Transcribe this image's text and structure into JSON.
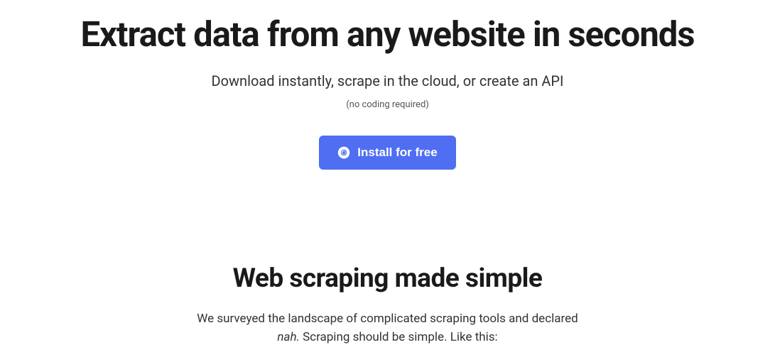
{
  "hero": {
    "title": "Extract data from any website in seconds",
    "subtitle": "Download instantly, scrape in the cloud, or create an API",
    "note": "(no coding required)",
    "cta_label": "Install for free"
  },
  "section": {
    "title": "Web scraping made simple",
    "body_part1": "We surveyed the landscape of complicated scraping tools and declared ",
    "body_italic": "nah.",
    "body_part2": " Scraping should be simple. Like this:"
  }
}
